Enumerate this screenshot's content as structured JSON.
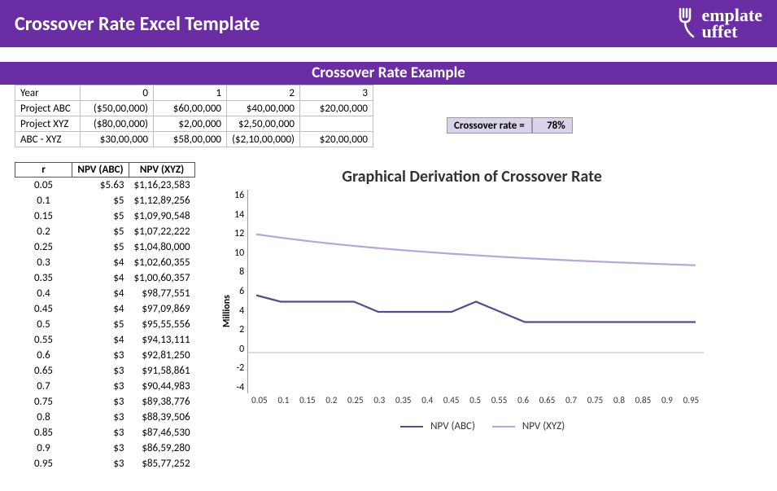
{
  "header": {
    "title": "Crossover Rate Excel Template",
    "logo_text": "emplate\nuffet"
  },
  "example_title": "Crossover Rate Example",
  "proj_table": {
    "row_year_label": "Year",
    "years": [
      "0",
      "1",
      "2",
      "3"
    ],
    "rows": [
      {
        "label": "Project ABC",
        "cells": [
          "($50,00,000)",
          "$60,00,000",
          "$40,00,000",
          "$20,00,000"
        ]
      },
      {
        "label": "Project XYZ",
        "cells": [
          "($80,00,000)",
          "$2,00,000",
          "$2,50,00,000",
          ""
        ]
      },
      {
        "label": "ABC - XYZ",
        "cells": [
          "$30,00,000",
          "$58,00,000",
          "($2,10,00,000)",
          "$20,00,000"
        ]
      }
    ]
  },
  "crossover": {
    "label": "Crossover rate =",
    "value": "78%"
  },
  "npv_table": {
    "headers": [
      "r",
      "NPV (ABC)",
      "NPV (XYZ)"
    ],
    "rows": [
      [
        "0.05",
        "$5.63",
        "$1,16,23,583"
      ],
      [
        "0.1",
        "$5",
        "$1,12,89,256"
      ],
      [
        "0.15",
        "$5",
        "$1,09,90,548"
      ],
      [
        "0.2",
        "$5",
        "$1,07,22,222"
      ],
      [
        "0.25",
        "$5",
        "$1,04,80,000"
      ],
      [
        "0.3",
        "$4",
        "$1,02,60,355"
      ],
      [
        "0.35",
        "$4",
        "$1,00,60,357"
      ],
      [
        "0.4",
        "$4",
        "$98,77,551"
      ],
      [
        "0.45",
        "$4",
        "$97,09,869"
      ],
      [
        "0.5",
        "$5",
        "$95,55,556"
      ],
      [
        "0.55",
        "$4",
        "$94,13,111"
      ],
      [
        "0.6",
        "$3",
        "$92,81,250"
      ],
      [
        "0.65",
        "$3",
        "$91,58,861"
      ],
      [
        "0.7",
        "$3",
        "$90,44,983"
      ],
      [
        "0.75",
        "$3",
        "$89,38,776"
      ],
      [
        "0.8",
        "$3",
        "$88,39,506"
      ],
      [
        "0.85",
        "$3",
        "$87,46,530"
      ],
      [
        "0.9",
        "$3",
        "$86,59,280"
      ],
      [
        "0.95",
        "$3",
        "$85,77,252"
      ]
    ]
  },
  "chart_data": {
    "type": "line",
    "title": "Graphical Derivation of Crossover Rate",
    "ylabel": "Millions",
    "xlabel": "",
    "ylim": [
      -4,
      16
    ],
    "x": [
      0.05,
      0.1,
      0.15,
      0.2,
      0.25,
      0.3,
      0.35,
      0.4,
      0.45,
      0.5,
      0.55,
      0.6,
      0.65,
      0.7,
      0.75,
      0.8,
      0.85,
      0.9,
      0.95
    ],
    "yticks": [
      16,
      14,
      12,
      10,
      8,
      6,
      4,
      2,
      0,
      -2,
      -4
    ],
    "series": [
      {
        "name": "NPV (ABC)",
        "color": "#5b4a8a",
        "values": [
          5.63,
          5,
          5,
          5,
          5,
          4,
          4,
          4,
          4,
          5,
          4,
          3,
          3,
          3,
          3,
          3,
          3,
          3,
          3
        ]
      },
      {
        "name": "NPV (XYZ)",
        "color": "#b6a8d6",
        "values": [
          11.62,
          11.29,
          10.99,
          10.72,
          10.48,
          10.26,
          10.06,
          9.88,
          9.71,
          9.56,
          9.41,
          9.28,
          9.16,
          9.04,
          8.94,
          8.84,
          8.75,
          8.66,
          8.58
        ]
      }
    ],
    "legend_position": "bottom"
  }
}
